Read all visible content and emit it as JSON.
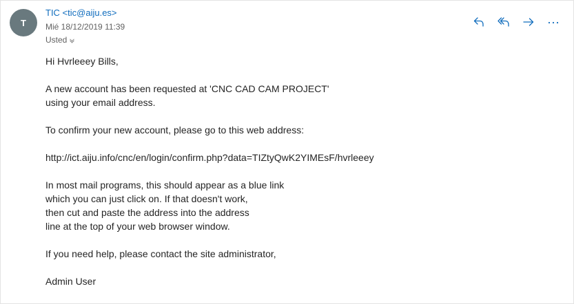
{
  "message": {
    "avatar_initial": "T",
    "sender": "TIC <tic@aiju.es>",
    "date": "Mié 18/12/2019 11:39",
    "recipient": "Usted",
    "accent_color": "#0f6cbd"
  },
  "actions": [
    {
      "icon": "reply-icon"
    },
    {
      "icon": "reply-all-icon"
    },
    {
      "icon": "forward-icon"
    },
    {
      "icon": "more-icon"
    }
  ],
  "body": {
    "greeting": "Hi Hvrleeey Bills,",
    "para1_line1": "A new account has been requested at 'CNC CAD CAM PROJECT'",
    "para1_line2": "using your email address.",
    "para2": "To confirm your new account, please go to this web address:",
    "link": "http://ict.aiju.info/cnc/en/login/confirm.php?data=TIZtyQwK2YIMEsF/hvrleeey",
    "para3_line1": "In most mail programs, this should appear as a blue link",
    "para3_line2": "which you can just click on. If that doesn't work,",
    "para3_line3": "then cut and paste the address into the address",
    "para3_line4": "line at the top of your web browser window.",
    "para4": "If you need help, please contact the site administrator,",
    "signature": "Admin User"
  }
}
